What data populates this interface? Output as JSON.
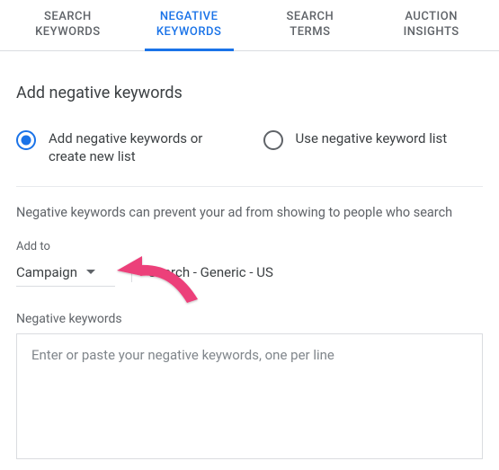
{
  "tabs": {
    "search_keywords": "SEARCH\nKEYWORDS",
    "negative_keywords": "NEGATIVE\nKEYWORDS",
    "search_terms": "SEARCH\nTERMS",
    "auction_insights": "AUCTION\nINSIGHTS"
  },
  "heading": "Add negative keywords",
  "radio": {
    "add_new": "Add negative keywords or create new list",
    "use_list": "Use negative keyword list"
  },
  "helper_text": "Negative keywords can prevent your ad from showing to people who search",
  "addto": {
    "label": "Add to",
    "scope": "Campaign",
    "target": "Search - Generic - US"
  },
  "negative_keywords": {
    "label": "Negative keywords",
    "placeholder": "Enter or paste your negative keywords, one per line"
  }
}
